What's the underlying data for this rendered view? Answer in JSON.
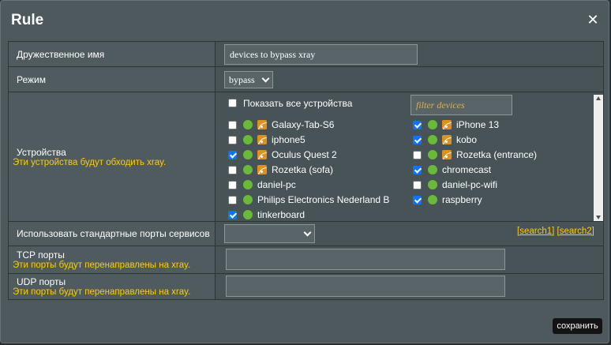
{
  "dialog": {
    "title": "Rule"
  },
  "rows": {
    "friendly_name": {
      "label": "Дружественное имя",
      "value": "devices to bypass xray"
    },
    "mode": {
      "label": "Режим",
      "value": "bypass"
    },
    "devices": {
      "label": "Устройства",
      "note": "Эти устройства будут обходить xray.",
      "show_all_label": "Показать все устройства",
      "show_all_checked": false,
      "filter_placeholder": "filter devices",
      "left": [
        {
          "name": "Galaxy-Tab-S6",
          "checked": false,
          "wifi": true
        },
        {
          "name": "iphone5",
          "checked": false,
          "wifi": true
        },
        {
          "name": "Oculus Quest 2",
          "checked": true,
          "wifi": true
        },
        {
          "name": "Rozetka (sofa)",
          "checked": false,
          "wifi": true
        },
        {
          "name": "daniel-pc",
          "checked": false,
          "wifi": false
        },
        {
          "name": "Philips Electronics Nederland B",
          "checked": false,
          "wifi": false
        },
        {
          "name": "tinkerboard",
          "checked": true,
          "wifi": false
        }
      ],
      "right": [
        {
          "name": "iPhone 13",
          "checked": true,
          "wifi": true
        },
        {
          "name": "kobo",
          "checked": true,
          "wifi": true
        },
        {
          "name": "Rozetka (entrance)",
          "checked": false,
          "wifi": true
        },
        {
          "name": "chromecast",
          "checked": true,
          "wifi": false
        },
        {
          "name": "daniel-pc-wifi",
          "checked": false,
          "wifi": false
        },
        {
          "name": "raspberry",
          "checked": true,
          "wifi": false
        }
      ]
    },
    "std_ports": {
      "label": "Использовать стандартные порты сервисов",
      "value": "",
      "link1": "[search1]",
      "link2": "[search2]"
    },
    "tcp": {
      "label": "TCP порты",
      "note": "Эти порты будут перенаправлены на xray.",
      "value": ""
    },
    "udp": {
      "label": "UDP порты",
      "note": "Эти порты будут перенаправлены на xray.",
      "value": ""
    }
  },
  "buttons": {
    "save": "сохранить"
  },
  "icons": {
    "close": "close-icon",
    "online": "status-dot-icon",
    "wifi": "wifi-icon"
  }
}
